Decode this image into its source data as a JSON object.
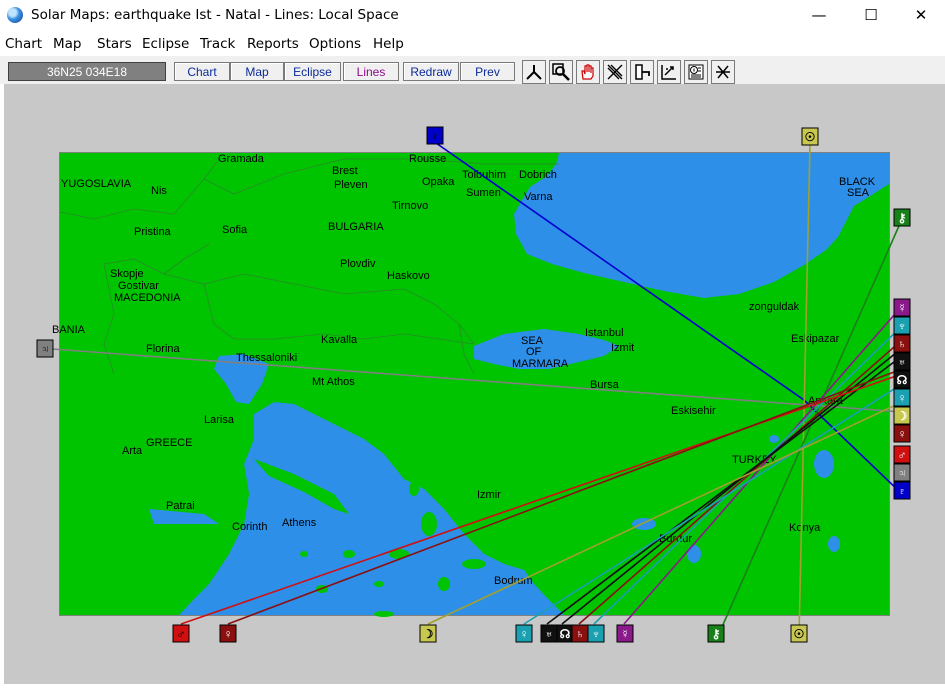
{
  "window": {
    "title": "Solar Maps: earthquake Ist - Natal - Lines: Local Space",
    "minimize": "—",
    "maximize": "☐",
    "close": "✕"
  },
  "menu": [
    "Chart",
    "Map",
    "Stars",
    "Eclipse",
    "Track",
    "Reports",
    "Options",
    "Help"
  ],
  "toolbar": {
    "coords": "36N25  034E18",
    "buttons": [
      "Chart",
      "Map",
      "Eclipse",
      "Lines",
      "Redraw",
      "Prev"
    ],
    "active": "Lines",
    "tools": [
      "compass-tool-icon",
      "zoom-tool-icon",
      "hand-tool-icon",
      "erase-lines-tool-icon",
      "door-tool-icon",
      "grid-tool-icon",
      "info-tool-icon",
      "crosshair-tool-icon"
    ]
  },
  "colors": {
    "land": "#00c400",
    "sea": "#2e8fe8",
    "background": "#c8c8c8"
  },
  "map": {
    "labels": [
      "YUGOSLAVIA",
      "Gramada",
      "Brest",
      "Pleven",
      "Rousse",
      "Tolbuhim",
      "Dobrich",
      "Opaka",
      "Sumen",
      "Varna",
      "Nis",
      "Tirnovo",
      "BLACK",
      "SEA",
      "Pristina",
      "Sofia",
      "BULGARIA",
      "Plovdiv",
      "Haskovo",
      "Skopje",
      "Gostivar",
      "MACEDONIA",
      "zonguldak",
      "BANIA",
      "Kavalla",
      "Eskipazar",
      "Istanbul",
      "Florina",
      "Thessaloniki",
      "SEA",
      "OF",
      "MARMARA",
      "Izmit",
      "Mt Athos",
      "Bursa",
      "Ankara",
      "Larisa",
      "Eskisehir",
      "GREECE",
      "Arta",
      "TURKEY",
      "Patrai",
      "Izmir",
      "Corinth",
      "Athens",
      "Burdur",
      "Konya",
      "Bodrum"
    ]
  },
  "planets": [
    {
      "id": "sun-top",
      "glyph": "☉",
      "color": "#c8c850"
    },
    {
      "id": "sun-bottom",
      "glyph": "☉",
      "color": "#c8c850"
    },
    {
      "id": "pluto",
      "glyph": "♇",
      "color": "#0000c8"
    },
    {
      "id": "jupiter-left",
      "glyph": "♃",
      "color": "#808080"
    },
    {
      "id": "chiron-right",
      "glyph": "⚷",
      "color": "#188018"
    },
    {
      "id": "chiron-bottom",
      "glyph": "⚷",
      "color": "#188018"
    },
    {
      "id": "mercury-right",
      "glyph": "☿",
      "color": "#8a1a8a"
    },
    {
      "id": "mercury-bottom",
      "glyph": "☿",
      "color": "#8a1a8a"
    },
    {
      "id": "neptune-right",
      "glyph": "♆",
      "color": "#1aa0b0"
    },
    {
      "id": "neptune-bottom",
      "glyph": "♆",
      "color": "#1aa0b0"
    },
    {
      "id": "saturn-right",
      "glyph": "♄",
      "color": "#8a1010"
    },
    {
      "id": "saturn-bottom",
      "glyph": "♄",
      "color": "#8a1010"
    },
    {
      "id": "uranus-right",
      "glyph": "♅",
      "color": "#101010"
    },
    {
      "id": "uranus-bottom",
      "glyph": "♅",
      "color": "#101010"
    },
    {
      "id": "node-right",
      "glyph": "☊",
      "color": "#101010"
    },
    {
      "id": "node-bottom",
      "glyph": "☊",
      "color": "#101010"
    },
    {
      "id": "venus-right",
      "glyph": "♀",
      "color": "#1aa0b0"
    },
    {
      "id": "venus-bottom",
      "glyph": "♀",
      "color": "#1aa0b0"
    },
    {
      "id": "moon-right",
      "glyph": "☽",
      "color": "#c8c850"
    },
    {
      "id": "moon-bottom",
      "glyph": "☽",
      "color": "#c8c850"
    },
    {
      "id": "mars-bottom",
      "glyph": "♂",
      "color": "#d01010"
    },
    {
      "id": "mars-right",
      "glyph": "♂",
      "color": "#d01010"
    },
    {
      "id": "venus2-right",
      "glyph": "♀",
      "color": "#8a1010"
    },
    {
      "id": "venus2-bottom",
      "glyph": "♀",
      "color": "#8a1010"
    },
    {
      "id": "jupiter-right",
      "glyph": "♃",
      "color": "#808080"
    },
    {
      "id": "pluto-right",
      "glyph": "♇",
      "color": "#0000c8"
    }
  ]
}
